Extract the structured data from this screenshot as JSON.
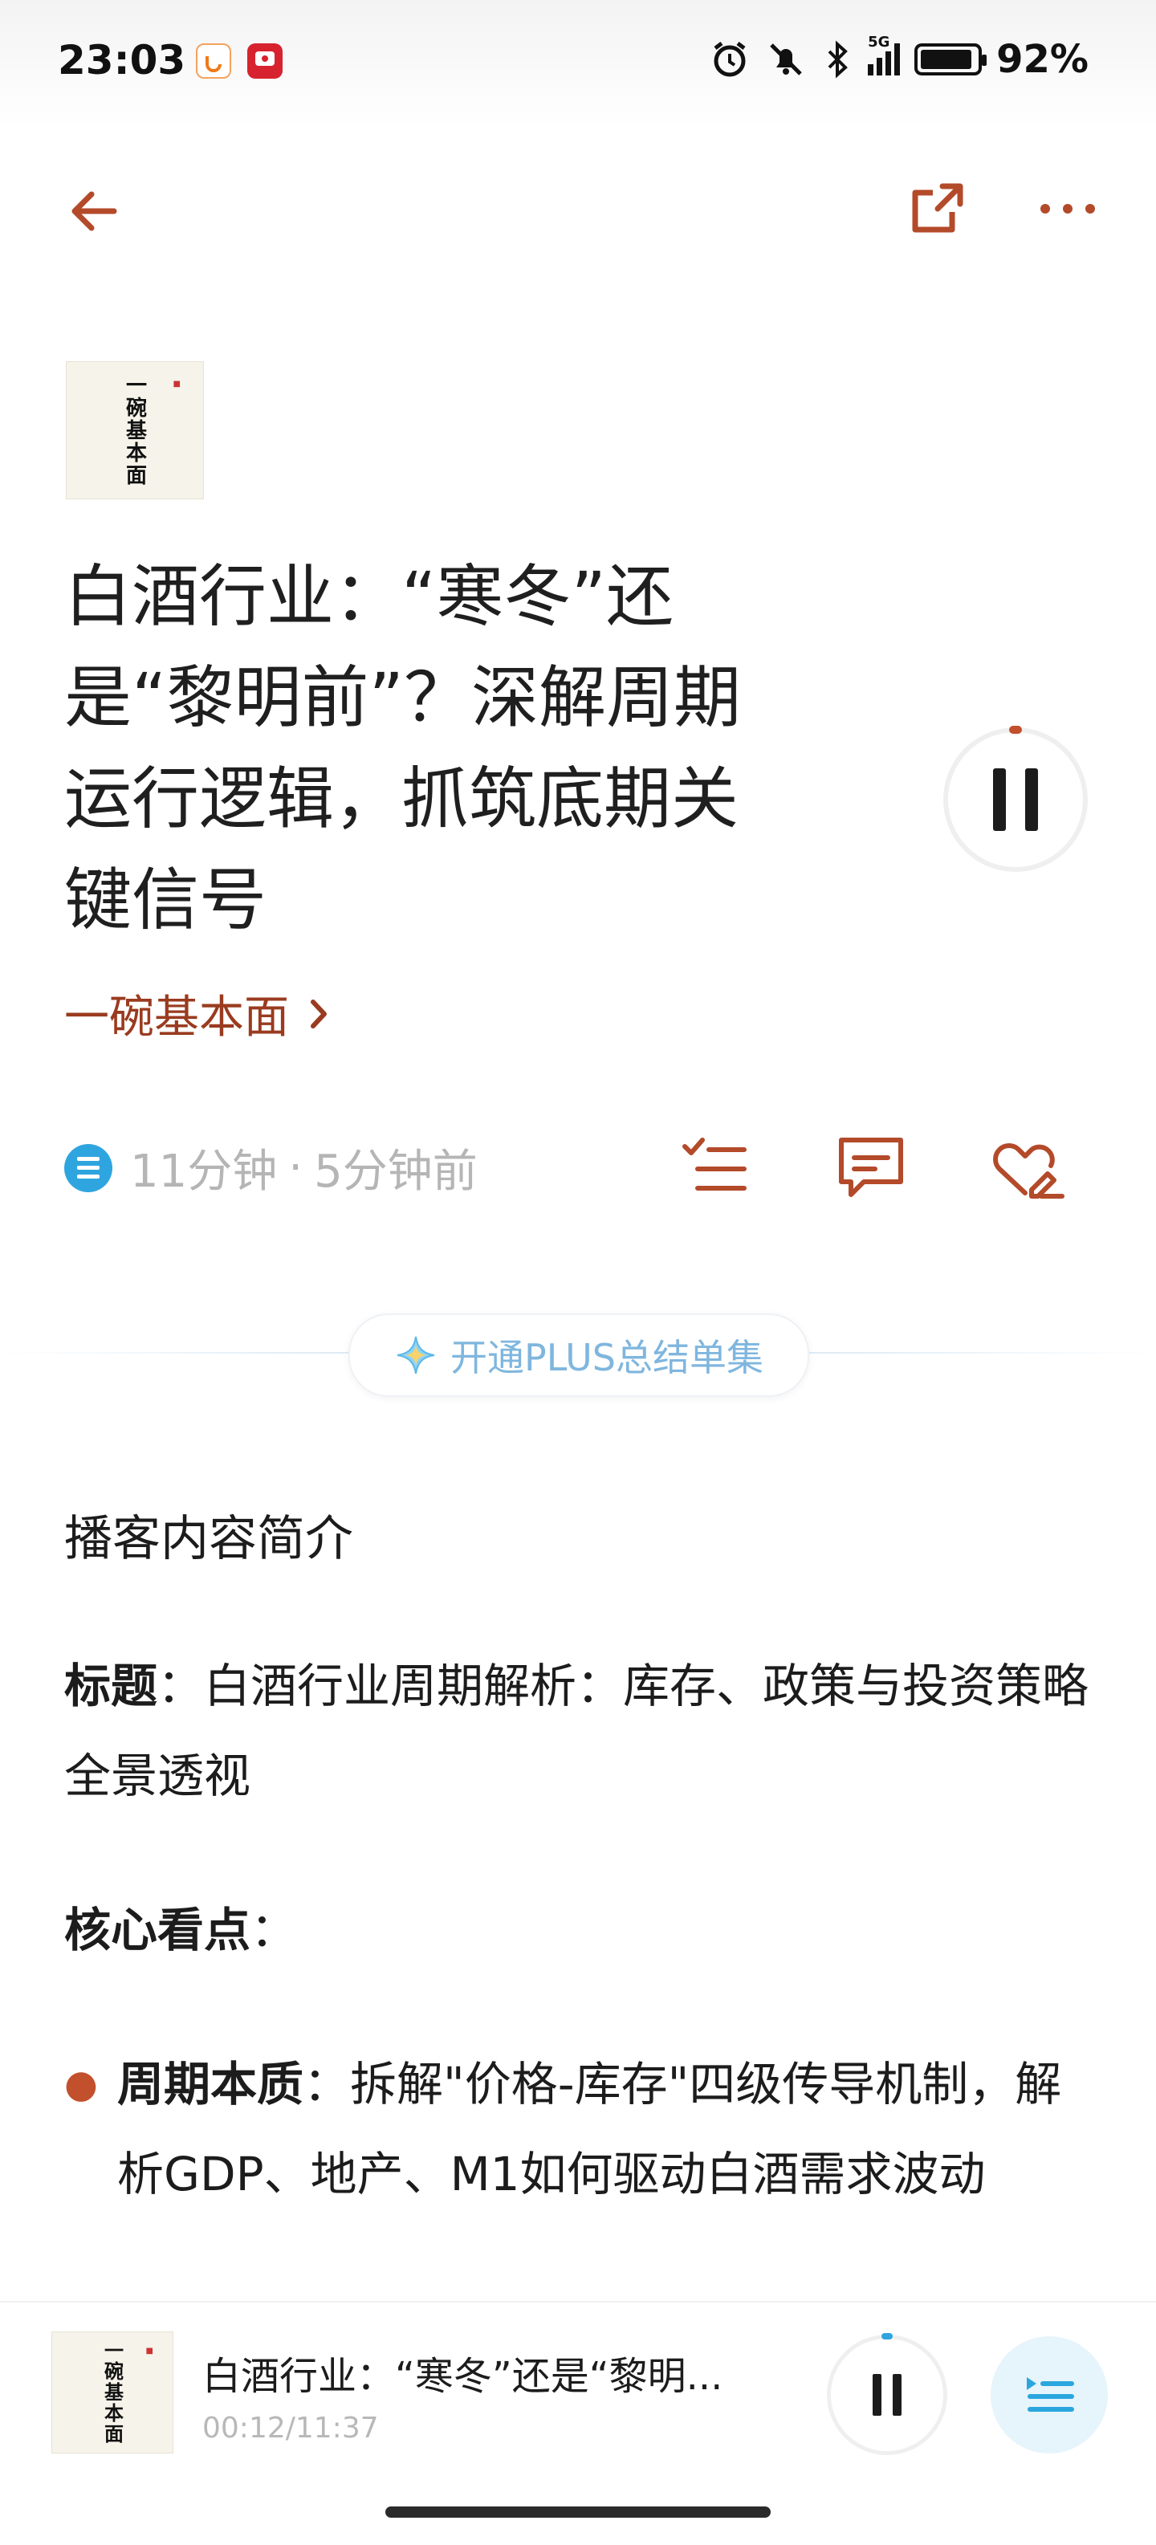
{
  "status_bar": {
    "time": "23:03",
    "signal_label": "5G",
    "battery": "92%"
  },
  "header": {
    "back_icon": "arrow-left-icon",
    "share_icon": "external-share-icon",
    "more_icon": "more-dots-icon",
    "accent_color": "#b34a2a"
  },
  "episode": {
    "cover_text": "一碗基本面",
    "title": "白酒行业：“寒冬”还是“黎明前”？深解周期运行逻辑，抓筑底期关键信号",
    "channel": "一碗基本面",
    "duration": "11分钟",
    "separator": "·",
    "published": "5分钟前"
  },
  "actions": {
    "plus_label": "开通PLUS总结单集"
  },
  "content": {
    "section_title": "播客内容简介",
    "title_label": "标题",
    "title_text": "：白酒行业周期解析：库存、政策与投资策略全景透视",
    "highlights_label": "核心看点",
    "highlights_colon": "：",
    "bullets": [
      {
        "label": "周期本质",
        "text": "：拆解\"价格-库存\"四级传导机制，解析GDP、地产、M1如何驱动白酒需求波动"
      }
    ]
  },
  "mini_player": {
    "cover_text": "一碗基本面",
    "title": "白酒行业：“寒冬”还是“黎明...",
    "time": "00:12/11:37"
  }
}
